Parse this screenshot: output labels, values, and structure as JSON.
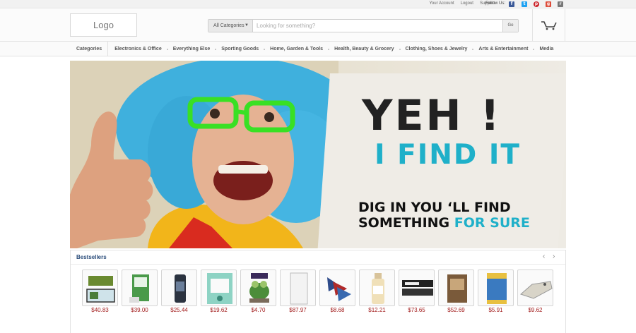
{
  "topbar": {
    "links": [
      "Your Account",
      "Logout",
      "Support"
    ],
    "follow_label": "Follow Us:",
    "social": [
      {
        "name": "facebook",
        "glyph": "f",
        "color": "#3b5998"
      },
      {
        "name": "twitter",
        "glyph": "t",
        "color": "#1da1f2"
      },
      {
        "name": "pinterest",
        "glyph": "p",
        "color": "#cb2027"
      },
      {
        "name": "google-plus",
        "glyph": "g",
        "color": "#dd4b39"
      },
      {
        "name": "rss",
        "glyph": "r",
        "color": "#777777"
      }
    ]
  },
  "header": {
    "logo": "Logo",
    "search": {
      "category": "All Categories",
      "placeholder": "Looking for something?",
      "button": "Go"
    },
    "cart_icon": "cart-icon"
  },
  "nav": {
    "items": [
      "Categories",
      "Electronics & Office",
      "Everything Else",
      "Sporting Goods",
      "Home, Garden & Tools",
      "Health, Beauty & Grocery",
      "Clothing, Shoes & Jewelry",
      "Arts & Entertainment",
      "Media"
    ]
  },
  "hero": {
    "headline": "YEH !",
    "subheadline": "I FIND IT",
    "line1": "DIG IN YOU ‘LL FIND",
    "line2": "SOMETHING",
    "line2_highlight": "FOR SURE",
    "accent_color": "#1fb0c9"
  },
  "bestsellers": {
    "title": "Bestsellers",
    "prev_icon": "chevron-left-icon",
    "next_icon": "chevron-right-icon",
    "products": [
      {
        "price": "$40.83",
        "kind": "aquarium"
      },
      {
        "price": "$39.00",
        "kind": "green-box"
      },
      {
        "price": "$25.44",
        "kind": "dark-can"
      },
      {
        "price": "$19.62",
        "kind": "teal-package"
      },
      {
        "price": "$4.70",
        "kind": "frog-figure"
      },
      {
        "price": "$87.97",
        "kind": "white-cabinet"
      },
      {
        "price": "$8.68",
        "kind": "fish-nets"
      },
      {
        "price": "$12.21",
        "kind": "bottle"
      },
      {
        "price": "$73.65",
        "kind": "led-bar"
      },
      {
        "price": "$52.69",
        "kind": "food-bag"
      },
      {
        "price": "$5.91",
        "kind": "food-can"
      },
      {
        "price": "$9.62",
        "kind": "gator-skull"
      }
    ]
  }
}
